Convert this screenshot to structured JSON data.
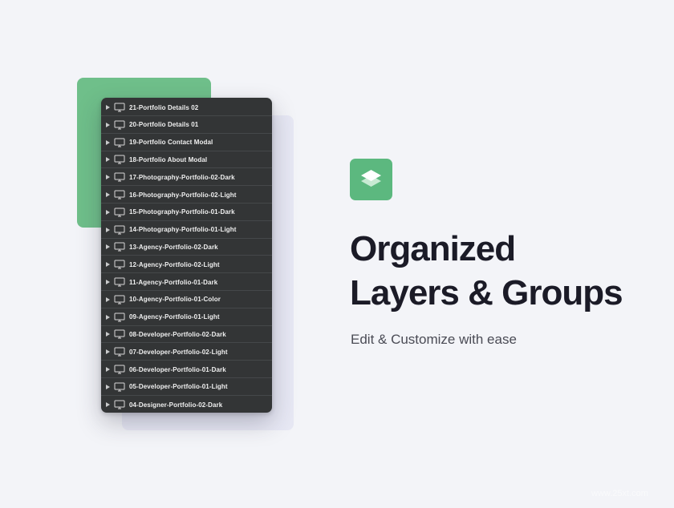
{
  "layers_panel": {
    "rows": [
      {
        "label": "21-Portfolio Details 02"
      },
      {
        "label": "20-Portfolio Details 01"
      },
      {
        "label": "19-Portfolio Contact Modal"
      },
      {
        "label": "18-Portfolio About Modal"
      },
      {
        "label": "17-Photography-Portfolio-02-Dark"
      },
      {
        "label": "16-Photography-Portfolio-02-Light"
      },
      {
        "label": "15-Photography-Portfolio-01-Dark"
      },
      {
        "label": "14-Photography-Portfolio-01-Light"
      },
      {
        "label": "13-Agency-Portfolio-02-Dark"
      },
      {
        "label": "12-Agency-Portfolio-02-Light"
      },
      {
        "label": "11-Agency-Portfolio-01-Dark"
      },
      {
        "label": "10-Agency-Portfolio-01-Color"
      },
      {
        "label": "09-Agency-Portfolio-01-Light"
      },
      {
        "label": "08-Developer-Portfolio-02-Dark"
      },
      {
        "label": "07-Developer-Portfolio-02-Light"
      },
      {
        "label": "06-Developer-Portfolio-01-Dark"
      },
      {
        "label": "05-Developer-Portfolio-01-Light"
      },
      {
        "label": "04-Designer-Portfolio-02-Dark"
      }
    ],
    "row_icon": "artboard-icon",
    "expand_icon": "caret-right-icon"
  },
  "hero": {
    "icon": "layers-icon",
    "title_line1": "Organized",
    "title_line2": "Layers & Groups",
    "subtitle": "Edit & Customize with ease"
  },
  "watermark": {
    "text": "www.25xt.com"
  },
  "colors": {
    "background": "#f3f4f8",
    "accent_green": "#5cb87f",
    "panel": "#333536",
    "headline": "#1b1b27"
  }
}
